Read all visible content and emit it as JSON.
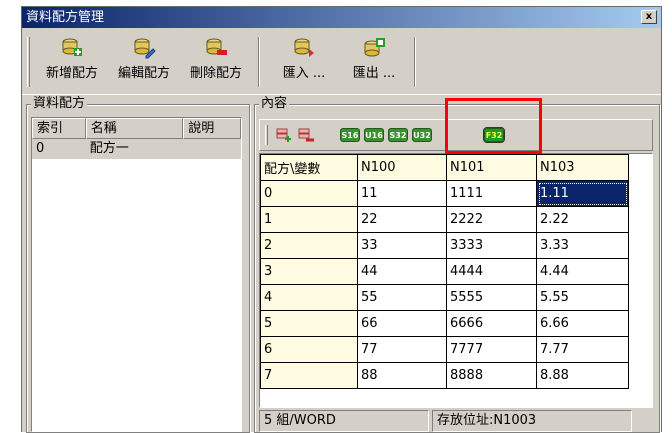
{
  "window": {
    "title": "資料配方管理",
    "close_label": "x"
  },
  "toolbar": {
    "buttons": [
      {
        "label": "新增配方",
        "icon": "add-recipe-icon"
      },
      {
        "label": "編輯配方",
        "icon": "edit-recipe-icon"
      },
      {
        "label": "刪除配方",
        "icon": "delete-recipe-icon"
      },
      {
        "label": "匯入 ...",
        "icon": "import-icon"
      },
      {
        "label": "匯出 ...",
        "icon": "export-icon"
      }
    ]
  },
  "left_panel": {
    "title": "資料配方",
    "columns": [
      "索引",
      "名稱",
      "說明"
    ],
    "rows": [
      {
        "index": "0",
        "name": "配方一",
        "desc": ""
      }
    ]
  },
  "right_panel": {
    "title": "內容",
    "formats": [
      "S16",
      "U16",
      "S32",
      "U32",
      "F32"
    ],
    "active_format": "F32",
    "grid": {
      "corner": "配方\\變數",
      "columns": [
        "N100",
        "N101",
        "N103"
      ],
      "rows": [
        {
          "label": "0",
          "cells": [
            "11",
            "1111",
            "1.11"
          ]
        },
        {
          "label": "1",
          "cells": [
            "22",
            "2222",
            "2.22"
          ]
        },
        {
          "label": "2",
          "cells": [
            "33",
            "3333",
            "3.33"
          ]
        },
        {
          "label": "3",
          "cells": [
            "44",
            "4444",
            "4.44"
          ]
        },
        {
          "label": "4",
          "cells": [
            "55",
            "5555",
            "5.55"
          ]
        },
        {
          "label": "5",
          "cells": [
            "66",
            "6666",
            "6.66"
          ]
        },
        {
          "label": "6",
          "cells": [
            "77",
            "7777",
            "7.77"
          ]
        },
        {
          "label": "7",
          "cells": [
            "88",
            "8888",
            "8.88"
          ]
        }
      ]
    },
    "status": {
      "size": "5 組/WORD",
      "address": "存放位址:N1003"
    }
  },
  "colors": {
    "title_start": "#0a246a",
    "title_end": "#a6caf0",
    "selection": "#0a246a",
    "highlight": "#ff0000",
    "header_bg": "#fffbe0"
  }
}
